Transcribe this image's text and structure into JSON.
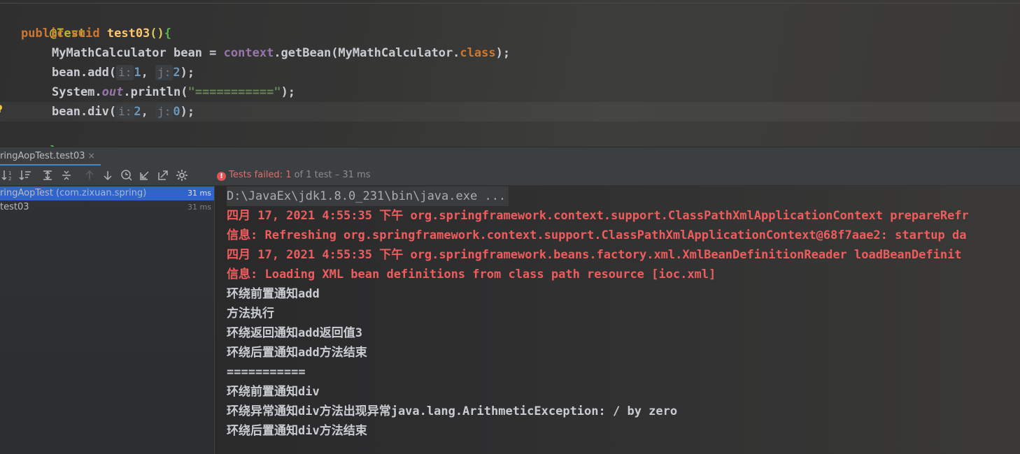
{
  "editor": {
    "lines": {
      "annotation": "@Test",
      "l2_kw_public": "public",
      "l2_kw_void": "void",
      "l2_method": "test03",
      "l2_paren": "()",
      "l2_brace": "{",
      "l3_type": "MyMathCalculator",
      "l3_var": " bean = ",
      "l3_context": "context",
      "l3_call": ".getBean(MyMathCalculator.",
      "l3_class": "class",
      "l3_end": ");",
      "l4_call": "bean.add(",
      "l4_hint_i": "i:",
      "l4_val_i": "1",
      "l4_comma": ",",
      "l4_hint_j": "j:",
      "l4_val_j": "2",
      "l4_end": ");",
      "l5_system": "System.",
      "l5_out": "out",
      "l5_println": ".println(",
      "l5_str": "\"===========\"",
      "l5_end": ");",
      "l6_call": "bean.div(",
      "l6_hint_i": "i:",
      "l6_val_i": "2",
      "l6_comma": ",",
      "l6_hint_j": "j:",
      "l6_val_j": "0",
      "l6_end": ");",
      "l7_brace": "}"
    },
    "gutter_icon": "lightbulb-icon"
  },
  "run_tab": {
    "label": "ringAopTest.test03",
    "close": "×"
  },
  "toolbar": {
    "icons": [
      "sort-alpha-icon",
      "sort-duration-icon",
      "expand-all-icon",
      "collapse-all-icon",
      "prev-failed-icon",
      "next-failed-icon",
      "history-icon",
      "import-tests-icon",
      "export-tests-icon",
      "settings-icon"
    ],
    "status_prefix": "Tests failed: ",
    "status_failed": "1",
    "status_mid": " of 1 test – ",
    "status_time": "31 ms"
  },
  "tree": {
    "root_name": "ringAopTest",
    "root_pkg": " (com.zixuan.spring)",
    "root_time": "31 ms",
    "child_name": "test03",
    "child_time": "31 ms"
  },
  "console": {
    "lines": [
      "D:\\JavaEx\\jdk1.8.0_231\\bin\\java.exe ...",
      "四月 17, 2021 4:55:35 下午 org.springframework.context.support.ClassPathXmlApplicationContext prepareRefr",
      "信息: Refreshing org.springframework.context.support.ClassPathXmlApplicationContext@68f7aae2: startup da",
      "四月 17, 2021 4:55:35 下午 org.springframework.beans.factory.xml.XmlBeanDefinitionReader loadBeanDefinit",
      "信息: Loading XML bean definitions from class path resource [ioc.xml]",
      "环绕前置通知add",
      "方法执行",
      "环绕返回通知add返回值3",
      "环绕后置通知add方法结束",
      "===========",
      "环绕前置通知div",
      "环绕异常通知div方法出现异常java.lang.ArithmeticException: / by zero",
      "环绕后置通知div方法结束"
    ]
  },
  "colors": {
    "keyword": "#cc7832",
    "method": "#ffc66d",
    "number": "#6897bb",
    "error_text": "#ee5d5d",
    "selection": "#2f65ca"
  }
}
